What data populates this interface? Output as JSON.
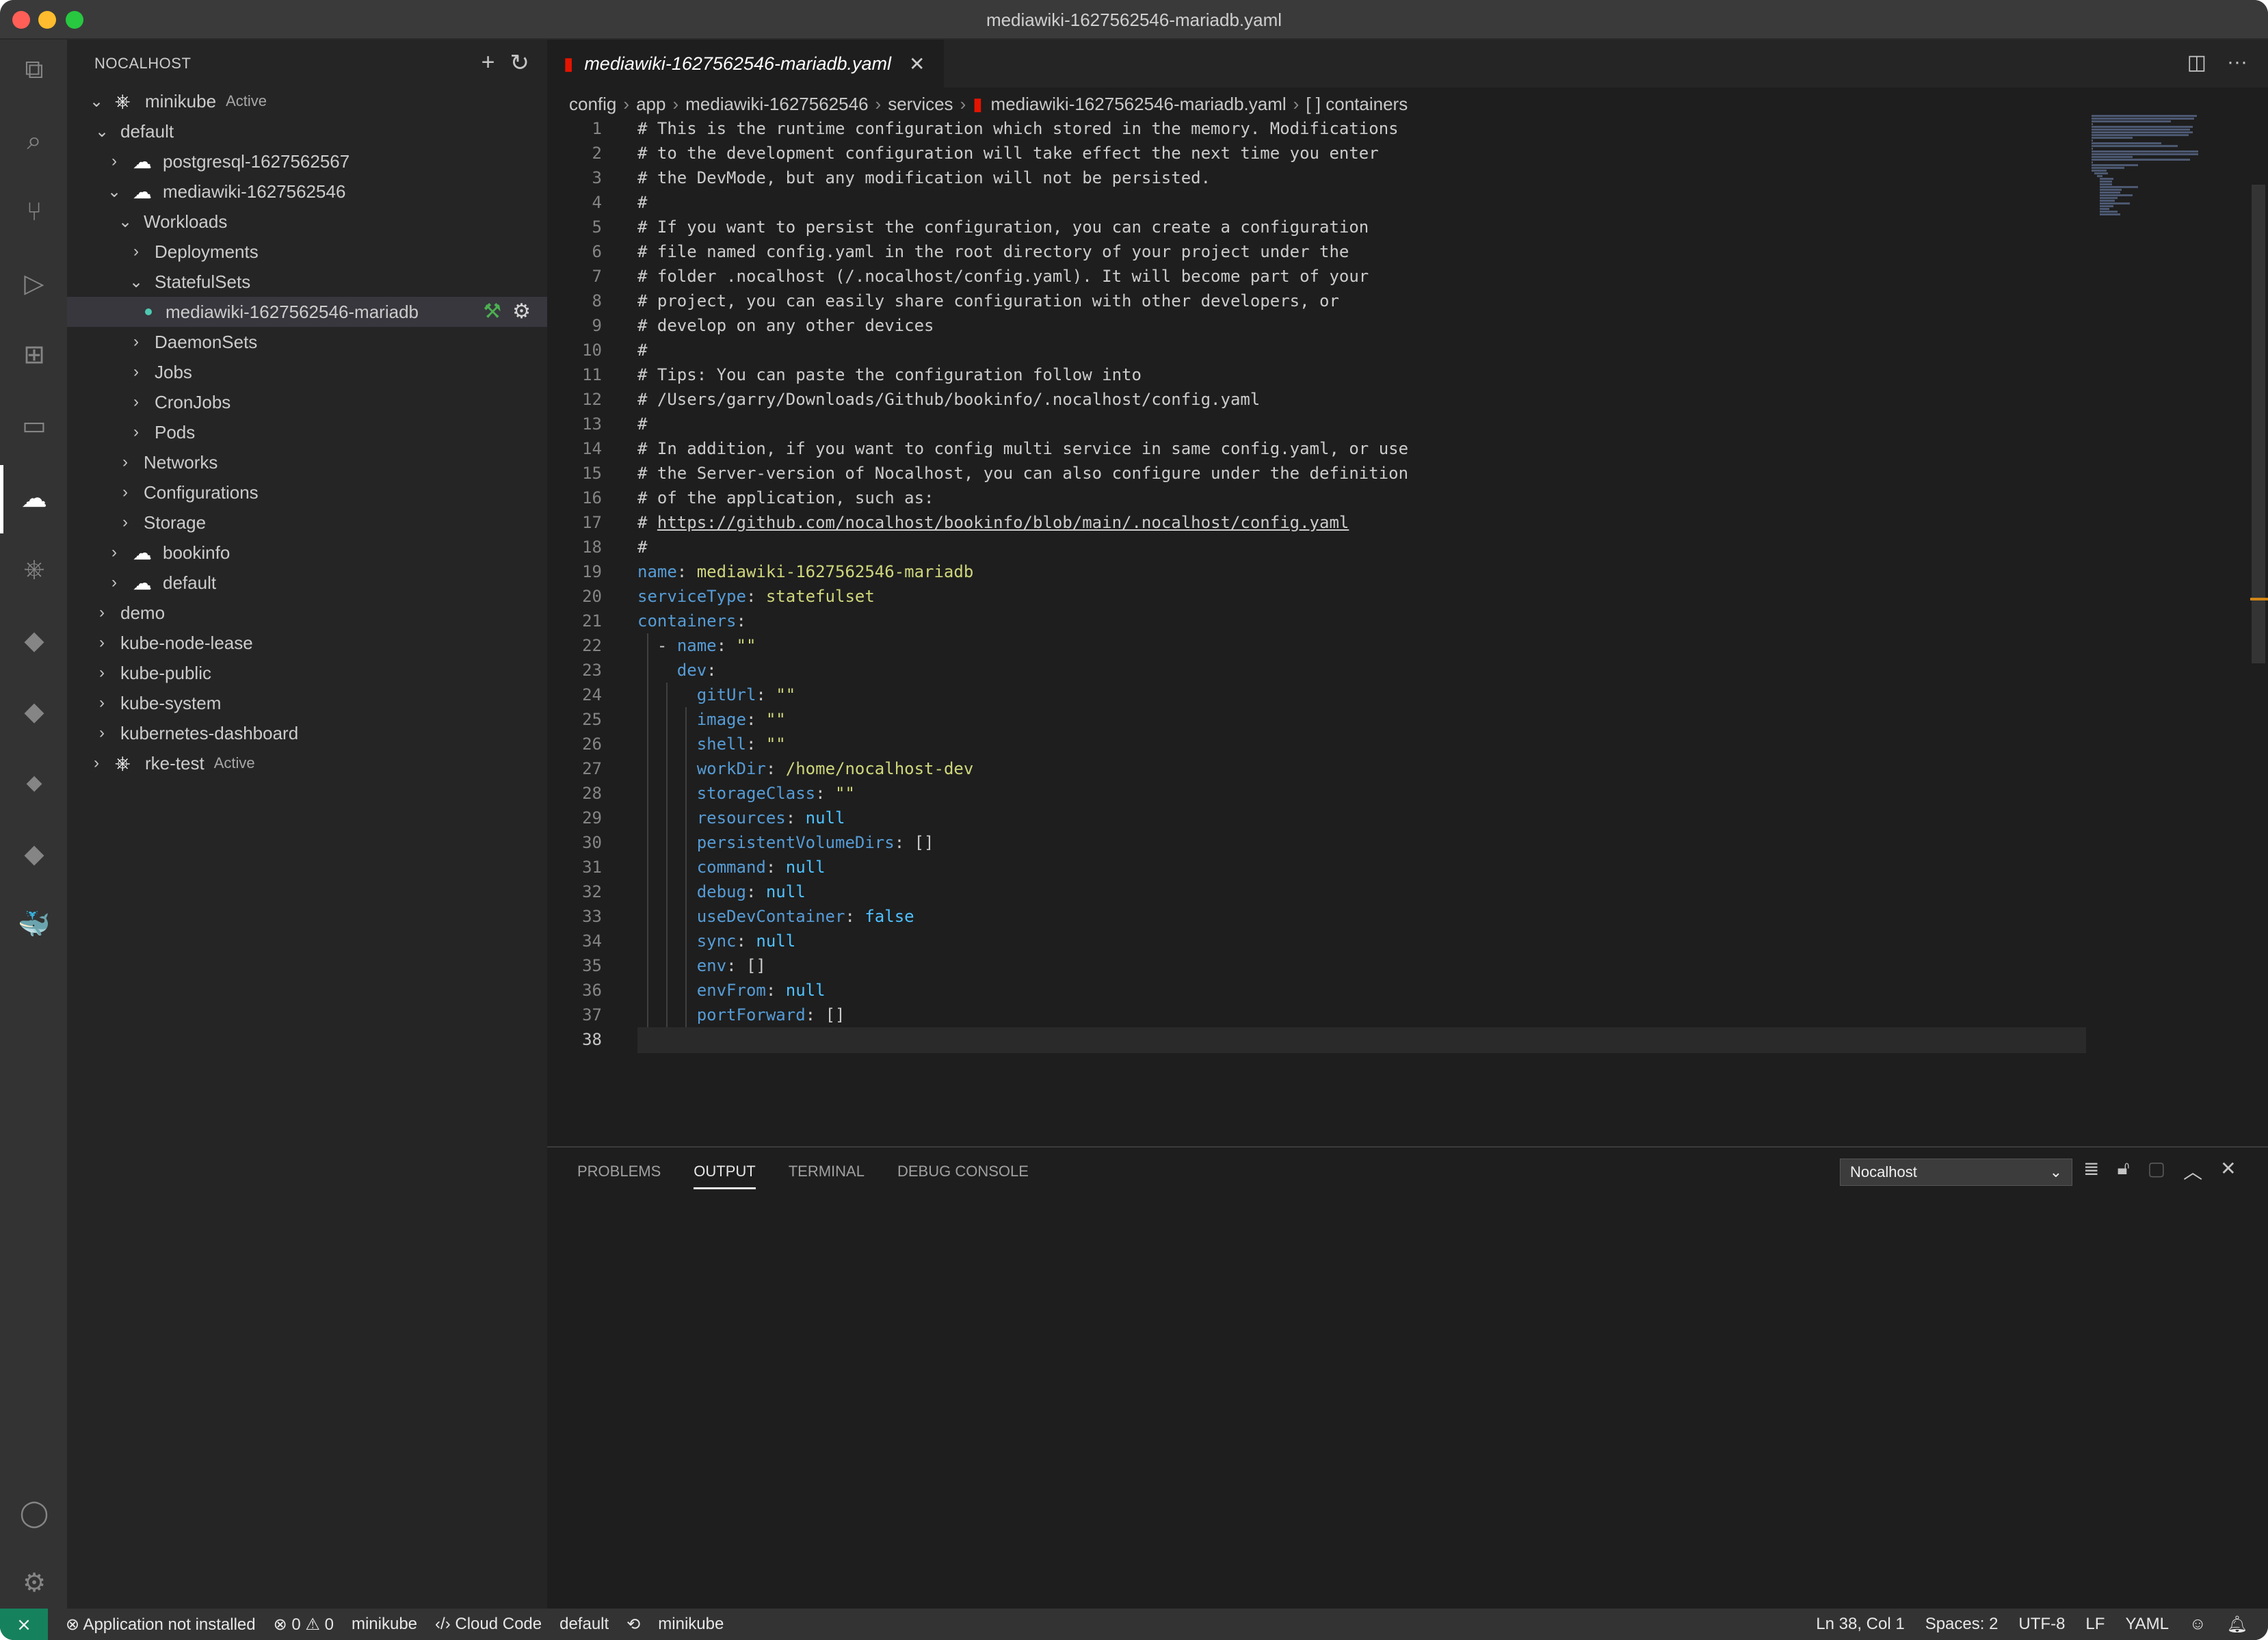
{
  "window": {
    "title": "mediawiki-1627562546-mariadb.yaml"
  },
  "activity_bar": {
    "icons": [
      "files-icon",
      "search-icon",
      "source-control-icon",
      "run-debug-icon",
      "extensions-icon",
      "remote-explorer-icon",
      "nocalhost-icon",
      "kubernetes-icon",
      "cloud-code-icon",
      "cloud-run-icon",
      "api-icon",
      "secret-manager-icon",
      "docker-icon",
      "account-icon",
      "settings-gear-icon"
    ]
  },
  "sidebar": {
    "title": "NOCALHOST",
    "tree": [
      {
        "label": "minikube",
        "badge": "Active"
      },
      {
        "label": "default"
      },
      {
        "label": "postgresql-1627562567"
      },
      {
        "label": "mediawiki-1627562546"
      },
      {
        "label": "Workloads"
      },
      {
        "label": "Deployments"
      },
      {
        "label": "StatefulSets"
      },
      {
        "label": "mediawiki-1627562546-mariadb"
      },
      {
        "label": "DaemonSets"
      },
      {
        "label": "Jobs"
      },
      {
        "label": "CronJobs"
      },
      {
        "label": "Pods"
      },
      {
        "label": "Networks"
      },
      {
        "label": "Configurations"
      },
      {
        "label": "Storage"
      },
      {
        "label": "bookinfo"
      },
      {
        "label": "default"
      },
      {
        "label": "demo"
      },
      {
        "label": "kube-node-lease"
      },
      {
        "label": "kube-public"
      },
      {
        "label": "kube-system"
      },
      {
        "label": "kubernetes-dashboard"
      },
      {
        "label": "rke-test",
        "badge": "Active"
      }
    ]
  },
  "editor": {
    "tab": {
      "label": "mediawiki-1627562546-mariadb.yaml"
    },
    "breadcrumb": [
      "config",
      "app",
      "mediawiki-1627562546",
      "services",
      "mediawiki-1627562546-mariadb.yaml",
      "[ ] containers"
    ],
    "lines": [
      "# This is the runtime configuration which stored in the memory. Modifications",
      "# to the development configuration will take effect the next time you enter",
      "# the DevMode, but any modification will not be persisted.",
      "#",
      "# If you want to persist the configuration, you can create a configuration",
      "# file named config.yaml in the root directory of your project under the",
      "# folder .nocalhost (/.nocalhost/config.yaml). It will become part of your",
      "# project, you can easily share configuration with other developers, or",
      "# develop on any other devices",
      "#",
      "# Tips: You can paste the configuration follow into",
      "# /Users/garry/Downloads/Github/bookinfo/.nocalhost/config.yaml",
      "#",
      "# In addition, if you want to config multi service in same config.yaml, or use",
      "# the Server-version of Nocalhost, you can also configure under the definition",
      "# of the application, such as:",
      "# https://github.com/nocalhost/bookinfo/blob/main/.nocalhost/config.yaml",
      "#",
      "name: mediawiki-1627562546-mariadb",
      "serviceType: statefulset",
      "containers:",
      "  - name: \"\"",
      "    dev:",
      "      gitUrl: \"\"",
      "      image: \"\"",
      "      shell: \"\"",
      "      workDir: /home/nocalhost-dev",
      "      storageClass: \"\"",
      "      resources: null",
      "      persistentVolumeDirs: []",
      "      command: null",
      "      debug: null",
      "      useDevContainer: false",
      "      sync: null",
      "      env: []",
      "      envFrom: null",
      "      portForward: []",
      ""
    ]
  },
  "panel": {
    "tabs": [
      "PROBLEMS",
      "OUTPUT",
      "TERMINAL",
      "DEBUG CONSOLE"
    ],
    "active_tab": "OUTPUT",
    "output_channel": "Nocalhost"
  },
  "statusbar": {
    "app_status": "Application not installed",
    "errors": "0",
    "warnings": "0",
    "cluster": "minikube",
    "cloud_code": "Cloud Code",
    "namespace": "default",
    "context": "minikube",
    "cursor": "Ln 38, Col 1",
    "spaces": "Spaces: 2",
    "encoding": "UTF-8",
    "eol": "LF",
    "language": "YAML"
  },
  "colors": {
    "accent_remote": "#16825d",
    "yaml_key": "#569cd6",
    "yaml_string": "#ce9178",
    "yaml_null": "#4fc1ff"
  }
}
